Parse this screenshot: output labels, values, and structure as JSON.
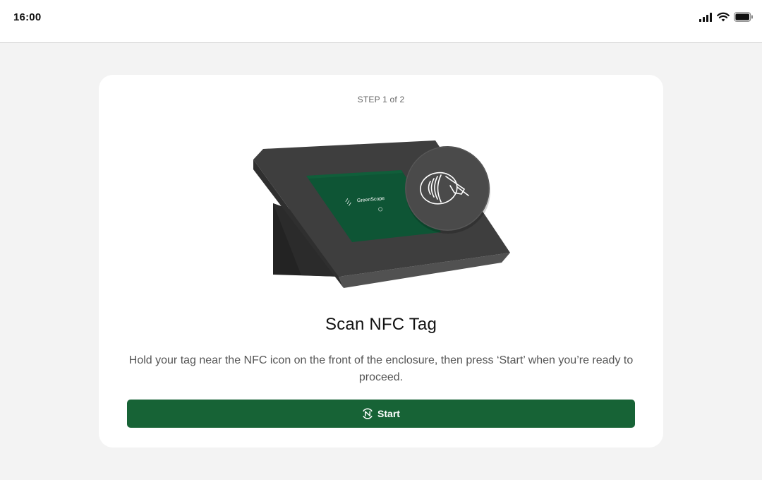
{
  "status_bar": {
    "time": "16:00",
    "icons": [
      "cellular-signal-icon",
      "wifi-icon",
      "battery-icon"
    ]
  },
  "card": {
    "step_label": "STEP 1 of 2",
    "title": "Scan NFC Tag",
    "description": "Hold your tag near the NFC icon on the front of the enclosure, then press ‘Start’ when you’re ready to proceed.",
    "start_button": {
      "label": "Start",
      "icon": "nfc-icon"
    }
  },
  "illustration": {
    "screen_brand": "GreenScope",
    "device": "tablet-kiosk-enclosure",
    "badge_icon": "nfc-tap-icon"
  },
  "colors": {
    "primary": "#176336",
    "screen_green": "#0e5535",
    "enclosure": "#3e3e3e",
    "background": "#f3f3f3"
  }
}
